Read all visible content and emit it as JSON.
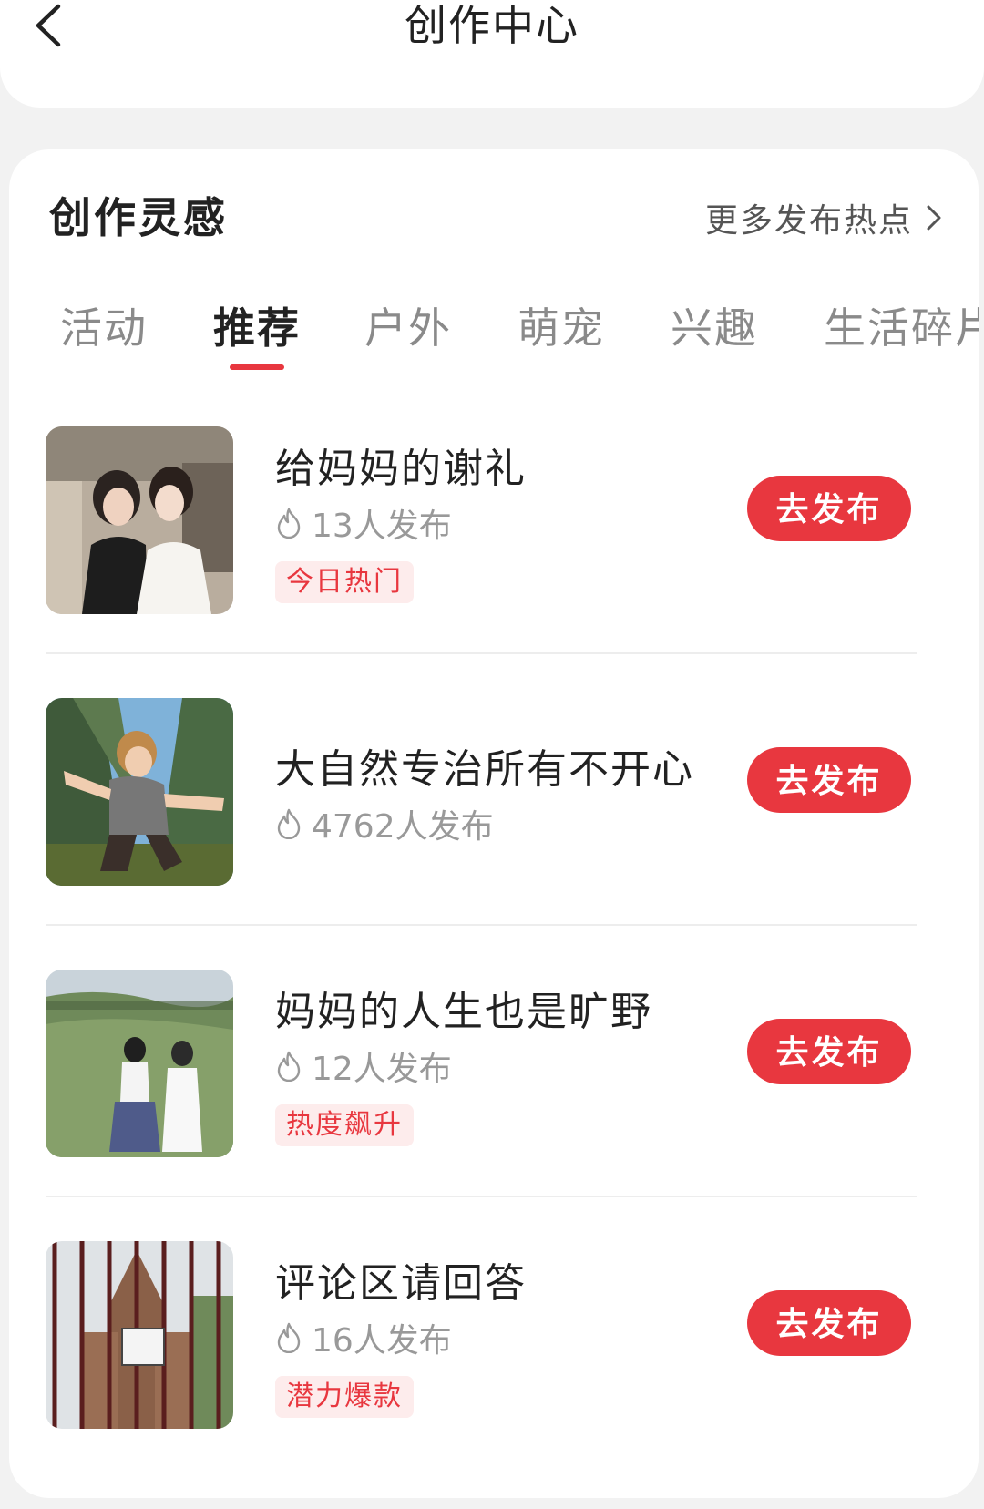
{
  "header": {
    "title": "创作中心"
  },
  "section": {
    "title": "创作灵感",
    "more_link": "更多发布热点"
  },
  "tabs": [
    {
      "label": "活动",
      "active": false
    },
    {
      "label": "推荐",
      "active": true
    },
    {
      "label": "户外",
      "active": false
    },
    {
      "label": "萌宠",
      "active": false
    },
    {
      "label": "兴趣",
      "active": false
    },
    {
      "label": "生活碎片",
      "active": false
    }
  ],
  "colors": {
    "accent": "#e8373f",
    "tag_bg": "#fdecec"
  },
  "items": [
    {
      "title": "给妈妈的谢礼",
      "count": "13人发布",
      "tag": "今日热门",
      "button": "去发布",
      "thumbnail": "mother-daughter-car-photo"
    },
    {
      "title": "大自然专治所有不开心",
      "count": "4762人发布",
      "tag": "",
      "button": "去发布",
      "thumbnail": "forest-low-angle-photo"
    },
    {
      "title": "妈妈的人生也是旷野",
      "count": "12人发布",
      "tag": "热度飙升",
      "button": "去发布",
      "thumbnail": "grassland-two-women-photo"
    },
    {
      "title": "评论区请回答",
      "count": "16人发布",
      "tag": "潜力爆款",
      "button": "去发布",
      "thumbnail": "church-gate-photo"
    }
  ]
}
